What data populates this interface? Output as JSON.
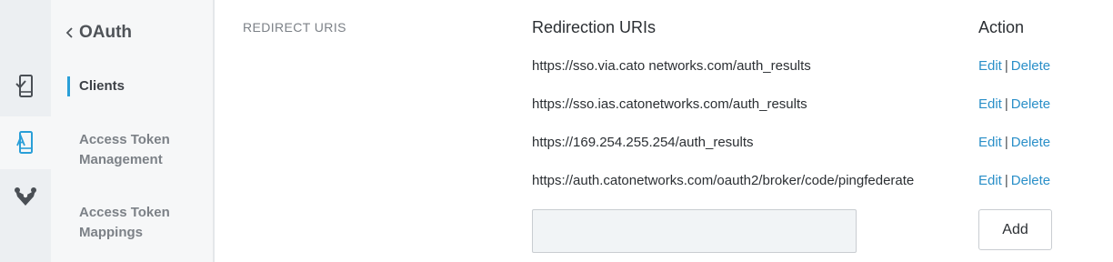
{
  "sidebar": {
    "rail_icons": [
      {
        "name": "mobile-check-icon",
        "active": false
      },
      {
        "name": "mobile-app-icon",
        "active": true
      },
      {
        "name": "network-icon",
        "active": false
      }
    ],
    "back_label": "OAuth",
    "items": [
      {
        "label": "Clients",
        "active": true
      },
      {
        "label": "Access Token\nManagement",
        "active": false
      },
      {
        "label": "Access Token\nMappings",
        "active": false
      }
    ]
  },
  "main": {
    "section_label": "REDIRECT URIS",
    "table": {
      "headers": {
        "uris": "Redirection URIs",
        "action": "Action"
      },
      "rows": [
        {
          "uri": "https://sso.via.cato networks.com/auth_results"
        },
        {
          "uri": "https://sso.ias.catonetworks.com/auth_results"
        },
        {
          "uri": "https://169.254.255.254/auth_results"
        },
        {
          "uri": "https://auth.catonetworks.com/oauth2/broker/code/pingfederate"
        }
      ],
      "edit_label": "Edit",
      "delete_label": "Delete",
      "separator": "|"
    },
    "new_uri": {
      "value": "",
      "placeholder": ""
    },
    "add_label": "Add"
  },
  "colors": {
    "accent": "#2a9fd8",
    "link": "#2a8fc8",
    "rail_bg": "#eceff2",
    "subnav_bg": "#f6f7f8"
  }
}
